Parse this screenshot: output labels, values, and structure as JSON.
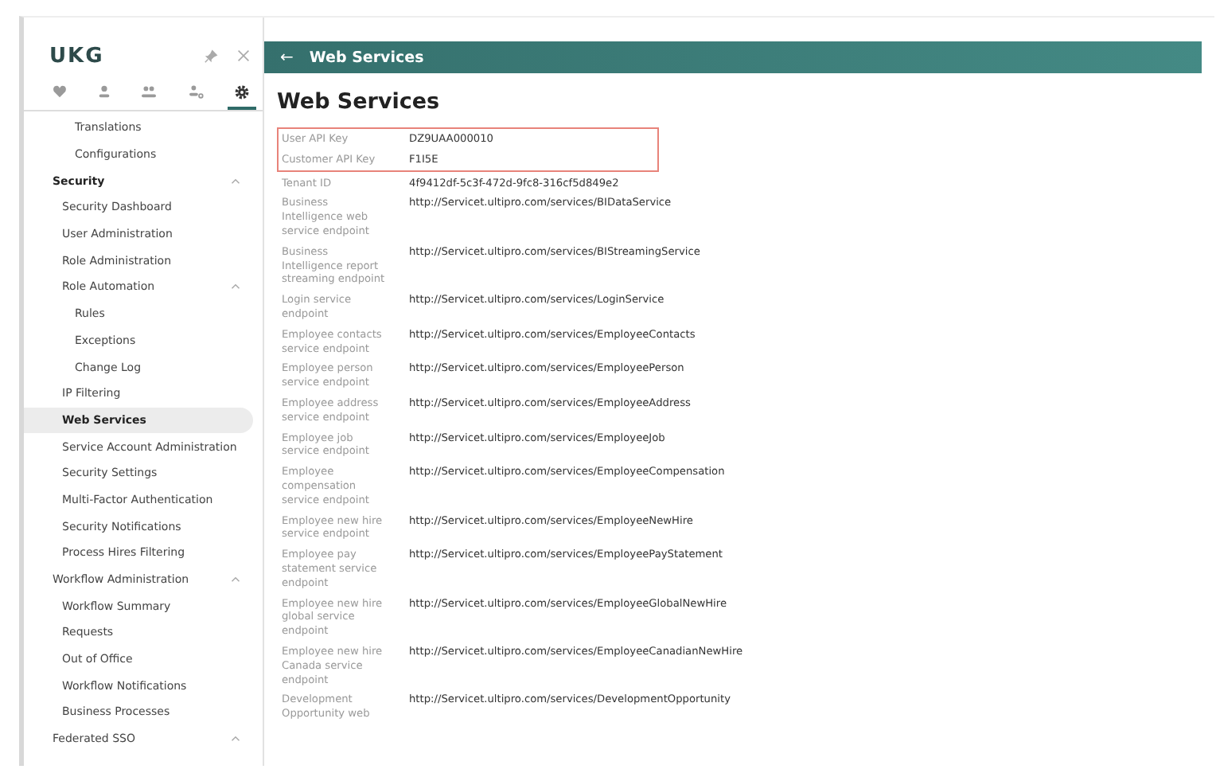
{
  "sidebar": {
    "logo": "UKG",
    "tabs": [
      {
        "selected": false
      },
      {
        "selected": false
      },
      {
        "selected": false
      },
      {
        "selected": false
      },
      {
        "selected": true
      }
    ],
    "nav": [
      {
        "children": [
          {
            "children": [
              {
                "label": "Translations",
                "selected": false
              },
              {
                "label": "Configurations",
                "selected": false
              }
            ]
          }
        ]
      },
      {
        "label": "Security",
        "expanded": true,
        "children": [
          {
            "label": "Security Dashboard",
            "selected": false
          },
          {
            "label": "User Administration",
            "selected": false
          },
          {
            "label": "Role Administration",
            "selected": false
          },
          {
            "label": "Role Automation",
            "expanded": true,
            "children": [
              {
                "label": "Rules",
                "selected": false
              },
              {
                "label": "Exceptions",
                "selected": false
              },
              {
                "label": "Change Log",
                "selected": false
              }
            ]
          },
          {
            "label": "IP Filtering",
            "selected": false
          },
          {
            "label": "Web Services",
            "selected": true
          },
          {
            "label": "Service Account Administration",
            "selected": false
          },
          {
            "label": "Security Settings",
            "selected": false
          },
          {
            "label": "Multi-Factor Authentication",
            "selected": false
          },
          {
            "label": "Security Notifications",
            "selected": false
          },
          {
            "label": "Process Hires Filtering",
            "selected": false
          }
        ]
      },
      {
        "label": "Workflow Administration",
        "expanded": true,
        "children": [
          {
            "label": "Workflow Summary",
            "selected": false
          },
          {
            "label": "Requests",
            "selected": false
          },
          {
            "label": "Out of Office",
            "selected": false
          },
          {
            "label": "Workflow Notifications",
            "selected": false
          },
          {
            "label": "Business Processes",
            "selected": false
          }
        ]
      },
      {
        "label": "Federated SSO",
        "expanded": true
      }
    ]
  },
  "header": {
    "back": "←",
    "title": "Web Services"
  },
  "page_title": "Web Services",
  "highlighted_rows": [
    {
      "label": "User API Key",
      "value": "DZ9UAA000010"
    },
    {
      "label": "Customer API Key",
      "value": "F1I5E"
    }
  ],
  "rows": [
    {
      "label": "Tenant ID",
      "value": "4f9412df-5c3f-472d-9fc8-316cf5d849e2"
    },
    {
      "label": "Business Intelligence web service endpoint",
      "value": "http://Servicet.ultipro.com/services/BIDataService"
    },
    {
      "label": "Business Intelligence report streaming endpoint",
      "value": "http://Servicet.ultipro.com/services/BIStreamingService"
    },
    {
      "label": "Login service endpoint",
      "value": "http://Servicet.ultipro.com/services/LoginService"
    },
    {
      "label": "Employee contacts service endpoint",
      "value": "http://Servicet.ultipro.com/services/EmployeeContacts"
    },
    {
      "label": "Employee person service endpoint",
      "value": "http://Servicet.ultipro.com/services/EmployeePerson"
    },
    {
      "label": "Employee address service endpoint",
      "value": "http://Servicet.ultipro.com/services/EmployeeAddress"
    },
    {
      "label": "Employee job service endpoint",
      "value": "http://Servicet.ultipro.com/services/EmployeeJob"
    },
    {
      "label": "Employee compensation service endpoint",
      "value": "http://Servicet.ultipro.com/services/EmployeeCompensation"
    },
    {
      "label": "Employee new hire service endpoint",
      "value": "http://Servicet.ultipro.com/services/EmployeeNewHire"
    },
    {
      "label": "Employee pay statement service endpoint",
      "value": "http://Servicet.ultipro.com/services/EmployeePayStatement"
    },
    {
      "label": "Employee new hire global service endpoint",
      "value": "http://Servicet.ultipro.com/services/EmployeeGlobalNewHire"
    },
    {
      "label": "Employee new hire Canada service endpoint",
      "value": "http://Servicet.ultipro.com/services/EmployeeCanadianNewHire"
    },
    {
      "label": "Development Opportunity web",
      "value": "http://Servicet.ultipro.com/services/DevelopmentOpportunity"
    }
  ]
}
